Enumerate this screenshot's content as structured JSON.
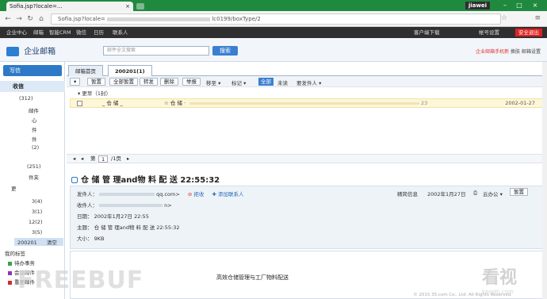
{
  "browser": {
    "tab_title": "Sofia.jsp?locale=...",
    "profile": "jiawei",
    "url": "Sofia.jsp?locale=",
    "url_tail": "lc0199/boxType/2"
  },
  "topnav": {
    "items": [
      "企业中心",
      "邮箱",
      "智能CRM",
      "微信",
      "日历",
      "联系人"
    ],
    "right_items": [
      "客户端下载",
      "帐号设置"
    ],
    "red_button": "安全退出"
  },
  "header": {
    "logo": "企业邮箱",
    "search_placeholder": "邮件全文搜索",
    "search_button": "搜索",
    "links": {
      "mobile": "企业邮箱手机新",
      "switch": "换肤",
      "settings": "邮箱设置"
    }
  },
  "sidebar": {
    "write": "写信",
    "inbox": "收信",
    "items": [
      {
        "label": "(312)"
      },
      {
        "label": "邮件"
      },
      {
        "label": "心"
      },
      {
        "label": "件"
      },
      {
        "label": "件"
      },
      {
        "label": "(2)"
      },
      {
        "label": "(251)"
      },
      {
        "label": "件夹"
      },
      {
        "label": "更"
      },
      {
        "label": "3(4)"
      },
      {
        "label": "3(1)"
      },
      {
        "label": "12(2)"
      },
      {
        "label": "3(5)"
      },
      {
        "label": "200201",
        "extra": "清空"
      },
      {
        "label": "我的标签"
      },
      {
        "label": "待办事务",
        "color": "#3aa24a"
      },
      {
        "label": "会议邮件",
        "color": "#8a3ab8"
      },
      {
        "label": "重要邮件",
        "color": "#d22d2d"
      }
    ]
  },
  "main": {
    "tabs": [
      "邮箱首页",
      "200201(1)"
    ],
    "toolbar": [
      "▾",
      "暂置",
      "全部暂置",
      "转发",
      "删除",
      "举报",
      "移至 ▾",
      "标记 ▾"
    ],
    "filters": [
      "全部",
      "未读",
      "要发件人 ▾"
    ],
    "group_label": "更早（1封）",
    "row": {
      "sender": "_ 仓 储 _",
      "subject": "仓 储 ·",
      "size": "23",
      "date": "2002-01-27"
    },
    "pager": {
      "page": "第",
      "num": "1",
      "total": "/1页",
      "next": "▸"
    },
    "subject": "仓 储 管 理and物 料 配 送 22:55:32",
    "meta": {
      "from_label": "发件人：",
      "from_tail": "qq.com>",
      "reject": "拒收",
      "add_contact": "添加联系人",
      "to_label": "收件人：",
      "to_tail": "n>",
      "date_label": "日期：",
      "date": "2002年1月27日 22:55",
      "subj_label": "主题：",
      "subj": "仓 储 管 理and物 料 配 送 22:55:32",
      "size_label": "大小：",
      "size": "9KB",
      "info": "精简信息",
      "date_right": "2002年1月27日",
      "cloud": "云办公 ▾",
      "reply": "暂置"
    },
    "body": "高效仓储管理与工厂物料配送"
  },
  "watermark": {
    "left": "FREEBUF",
    "right": "看视",
    "right_sub": "kanshi.com"
  },
  "footer": "© 2015 35.com Co., Ltd. All Rights Reserved."
}
